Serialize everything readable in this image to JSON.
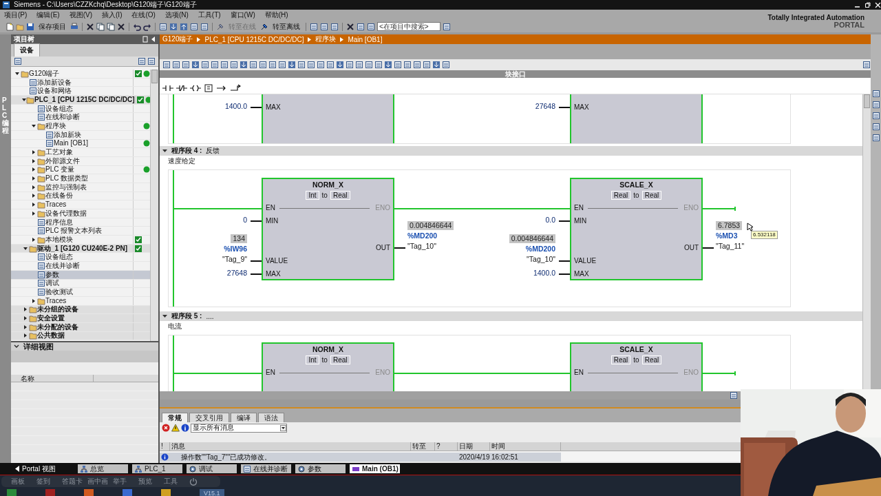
{
  "window": {
    "title": "Siemens  -  C:\\Users\\CZZKchq\\Desktop\\G120端子\\G120端子"
  },
  "menu": [
    "项目(P)",
    "编辑(E)",
    "视图(V)",
    "插入(I)",
    "在线(O)",
    "选项(N)",
    "工具(T)",
    "窗口(W)",
    "帮助(H)"
  ],
  "toolbar": {
    "save": "保存项目",
    "online": {
      "label": "转至在线",
      "disabled": true
    },
    "offline": {
      "label": "转至离线",
      "disabled": false
    },
    "search": {
      "placeholder": "<在项目中搜索>"
    }
  },
  "brand": {
    "line1": "Totally Integrated Automation",
    "line2": "PORTAL"
  },
  "side_tab": "PLC 编程",
  "project_tree": {
    "title": "项目树",
    "tab": "设备",
    "items": [
      {
        "label": "G120端子",
        "expanded": true,
        "selected": false,
        "check": true,
        "online": true,
        "children": [
          {
            "label": "添加新设备",
            "selected": false,
            "check": false,
            "online": false
          },
          {
            "label": "设备和网络",
            "selected": false,
            "check": false,
            "online": false
          },
          {
            "label": "PLC_1 [CPU 1215C DC/DC/DC]",
            "expanded": true,
            "selected": false,
            "check": true,
            "online": true,
            "children": [
              {
                "label": "设备组态",
                "selected": false,
                "check": false,
                "online": false
              },
              {
                "label": "在线和诊断",
                "selected": false,
                "check": false,
                "online": false
              },
              {
                "label": "程序块",
                "expanded": true,
                "selected": false,
                "check": false,
                "online": true,
                "children": [
                  {
                    "label": "添加新块",
                    "selected": false,
                    "check": false,
                    "online": false
                  },
                  {
                    "label": "Main [OB1]",
                    "selected": false,
                    "check": false,
                    "online": true
                  }
                ]
              },
              {
                "label": "工艺对象",
                "expanded": false,
                "selected": false,
                "check": false,
                "online": false
              },
              {
                "label": "外部源文件",
                "expanded": false,
                "selected": false,
                "check": false,
                "online": false
              },
              {
                "label": "PLC 变量",
                "expanded": false,
                "selected": false,
                "check": false,
                "online": true
              },
              {
                "label": "PLC 数据类型",
                "expanded": false,
                "selected": false,
                "check": false,
                "online": false
              },
              {
                "label": "监控与强制表",
                "expanded": false,
                "selected": false,
                "check": false,
                "online": false
              },
              {
                "label": "在线备份",
                "expanded": false,
                "selected": false,
                "check": false,
                "online": false
              },
              {
                "label": "Traces",
                "expanded": false,
                "selected": false,
                "check": false,
                "online": false
              },
              {
                "label": "设备代理数据",
                "expanded": false,
                "selected": false,
                "check": false,
                "online": false
              },
              {
                "label": "程序信息",
                "selected": false,
                "check": false,
                "online": false
              },
              {
                "label": "PLC 报警文本列表",
                "selected": false,
                "check": false,
                "online": false
              },
              {
                "label": "本地模块",
                "expanded": false,
                "selected": false,
                "check": true,
                "online": false
              }
            ]
          },
          {
            "label": "驱动_1 [G120 CU240E-2 PN]",
            "expanded": true,
            "selected": false,
            "check": true,
            "online": false,
            "children": [
              {
                "label": "设备组态",
                "selected": false,
                "check": false,
                "online": false
              },
              {
                "label": "在线并诊断",
                "selected": false,
                "check": false,
                "online": false
              },
              {
                "label": "参数",
                "selected": true,
                "check": false,
                "online": false
              },
              {
                "label": "调试",
                "selected": false,
                "check": false,
                "online": false
              },
              {
                "label": "验收测试",
                "selected": false,
                "check": false,
                "online": false
              },
              {
                "label": "Traces",
                "expanded": false,
                "selected": false,
                "check": false,
                "online": false
              }
            ]
          },
          {
            "label": "未分组的设备",
            "expanded": false,
            "selected": false,
            "check": false,
            "online": false
          },
          {
            "label": "安全设置",
            "expanded": false,
            "selected": false,
            "check": false,
            "online": false
          },
          {
            "label": "未分配的设备",
            "expanded": false,
            "selected": false,
            "check": false,
            "online": false
          },
          {
            "label": "公共数据",
            "expanded": false,
            "selected": false,
            "check": false,
            "online": false
          }
        ]
      }
    ]
  },
  "detail_view": {
    "title": "详细视图",
    "columns": [
      "名称"
    ]
  },
  "editor": {
    "breadcrumb": [
      "G120端子",
      "PLC_1 [CPU 1215C DC/DC/DC]",
      "程序块",
      "Main [OB1]"
    ],
    "block_interface": "块接口",
    "networks": [
      {
        "kind": "cut_top",
        "boxes": [
          {
            "inputs": [
              {
                "pin": "MAX",
                "operands": [
                  {
                    "text": "1400.0",
                    "kind": "const"
                  }
                ]
              }
            ]
          },
          {
            "inputs": [
              {
                "pin": "MAX",
                "operands": [
                  {
                    "text": "27648",
                    "kind": "const"
                  }
                ]
              }
            ]
          }
        ]
      },
      {
        "kind": "whole",
        "number": "程序段 4 :",
        "title": "反馈",
        "comment": "速度给定",
        "boxes": [
          {
            "name": "NORM_X",
            "types": [
              "Int",
              "to",
              "Real"
            ],
            "en": "EN",
            "eno": "ENO",
            "inputs": [
              {
                "pin": "MIN",
                "operands": [
                  {
                    "text": "0",
                    "kind": "const"
                  }
                ]
              },
              {
                "pin": "VALUE",
                "operands": [
                  {
                    "text": "134",
                    "kind": "monitor"
                  },
                  {
                    "text": "%IW96",
                    "kind": "address"
                  },
                  {
                    "text": "\"Tag_9\"",
                    "kind": "symbol"
                  }
                ]
              },
              {
                "pin": "MAX",
                "operands": [
                  {
                    "text": "27648",
                    "kind": "const"
                  }
                ]
              }
            ],
            "outputs": [
              {
                "pin": "OUT",
                "operands": [
                  {
                    "text": "0.004846644",
                    "kind": "monitor"
                  },
                  {
                    "text": "%MD200",
                    "kind": "address"
                  },
                  {
                    "text": "\"Tag_10\"",
                    "kind": "symbol"
                  }
                ]
              }
            ]
          },
          {
            "name": "SCALE_X",
            "types": [
              "Real",
              "to",
              "Real"
            ],
            "en": "EN",
            "eno": "ENO",
            "inputs": [
              {
                "pin": "MIN",
                "operands": [
                  {
                    "text": "0.0",
                    "kind": "const"
                  }
                ]
              },
              {
                "pin": "VALUE",
                "operands": [
                  {
                    "text": "0.004846644",
                    "kind": "monitor"
                  },
                  {
                    "text": "%MD200",
                    "kind": "address"
                  },
                  {
                    "text": "\"Tag_10\"",
                    "kind": "symbol"
                  }
                ]
              },
              {
                "pin": "MAX",
                "operands": [
                  {
                    "text": "1400.0",
                    "kind": "const"
                  }
                ]
              }
            ],
            "outputs": [
              {
                "pin": "OUT",
                "operands": [
                  {
                    "text": "6.7853",
                    "kind": "monitor"
                  },
                  {
                    "text": "%MD3",
                    "kind": "address"
                  },
                  {
                    "text": "\"Tag_11\"",
                    "kind": "symbol"
                  }
                ]
              }
            ]
          }
        ],
        "tooltip": "6.532118"
      },
      {
        "kind": "cut_bottom",
        "number": "程序段 5 :",
        "title": "....",
        "comment": "电流",
        "boxes": [
          {
            "name": "NORM_X",
            "types": [
              "Int",
              "to",
              "Real"
            ],
            "en": "EN",
            "eno": "ENO"
          },
          {
            "name": "SCALE_X",
            "types": [
              "Real",
              "to",
              "Real"
            ],
            "en": "EN",
            "eno": "ENO"
          }
        ]
      }
    ]
  },
  "inspector": {
    "tabs": [
      {
        "label": "常规",
        "selected": true
      },
      {
        "label": "交叉引用",
        "selected": false
      },
      {
        "label": "编译",
        "selected": false
      },
      {
        "label": "语法",
        "selected": false
      }
    ],
    "filter": "显示所有消息",
    "columns": [
      "!",
      "消息",
      "转至",
      "?",
      "日期",
      "时间"
    ],
    "rows": [
      {
        "kind": "info",
        "message": "操作数\"\"Tag_7\"\"已成功修改。",
        "date": "2020/4/19",
        "time": "16:02:51"
      }
    ]
  },
  "portal_bar": {
    "portal_view": "Portal 视图",
    "tabs": [
      {
        "label": "总览",
        "selected": false
      },
      {
        "label": "PLC_1",
        "selected": false
      },
      {
        "label": "调试",
        "selected": false
      },
      {
        "label": "在线并诊断",
        "selected": false
      },
      {
        "label": "参数",
        "selected": false
      },
      {
        "label": "Main (OB1)",
        "selected": true
      }
    ]
  },
  "stream_toolbar": [
    "画板",
    "签到",
    "答题卡",
    "画中画",
    "举手",
    "预览",
    "工具"
  ],
  "taskbar": {
    "version": "V15.1"
  },
  "camera": {
    "kind": "picture"
  }
}
